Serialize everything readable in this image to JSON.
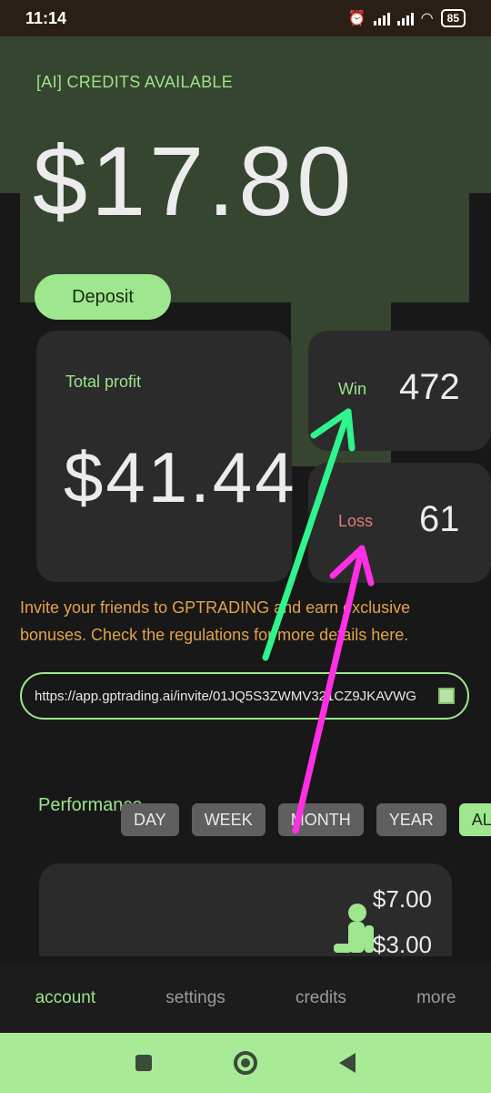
{
  "status_bar": {
    "time": "11:14",
    "battery": "85"
  },
  "hero": {
    "label": "[AI] CREDITS AVAILABLE",
    "amount": "$17.80",
    "deposit_label": "Deposit"
  },
  "stats": {
    "profit_label": "Total profit",
    "profit_value": "$41.44",
    "win_label": "Win",
    "win_value": "472",
    "loss_label": "Loss",
    "loss_value": "61"
  },
  "invite": {
    "text": "Invite your friends to GPTRADING and earn exclusive bonuses. Check the regulations for more details here.",
    "url": "https://app.gptrading.ai/invite/01JQ5S3ZWMV321CZ9JKAVWG"
  },
  "performance": {
    "label": "Performance",
    "tabs": [
      "DAY",
      "WEEK",
      "MONTH",
      "YEAR",
      "ALL"
    ],
    "active_tab": "ALL",
    "chart_labels": [
      "$7.00",
      "$3.00"
    ]
  },
  "bottom_nav": {
    "items": [
      "account",
      "settings",
      "credits",
      "more"
    ],
    "active": "account"
  },
  "colors": {
    "accent": "#9fe78f",
    "hero_bg": "#35452f",
    "card_bg": "#2b2b2b",
    "loss": "#e07b7b",
    "invite_text": "#e1a24a",
    "annotation_green": "#2ef58d",
    "annotation_magenta": "#ff2fe3"
  }
}
